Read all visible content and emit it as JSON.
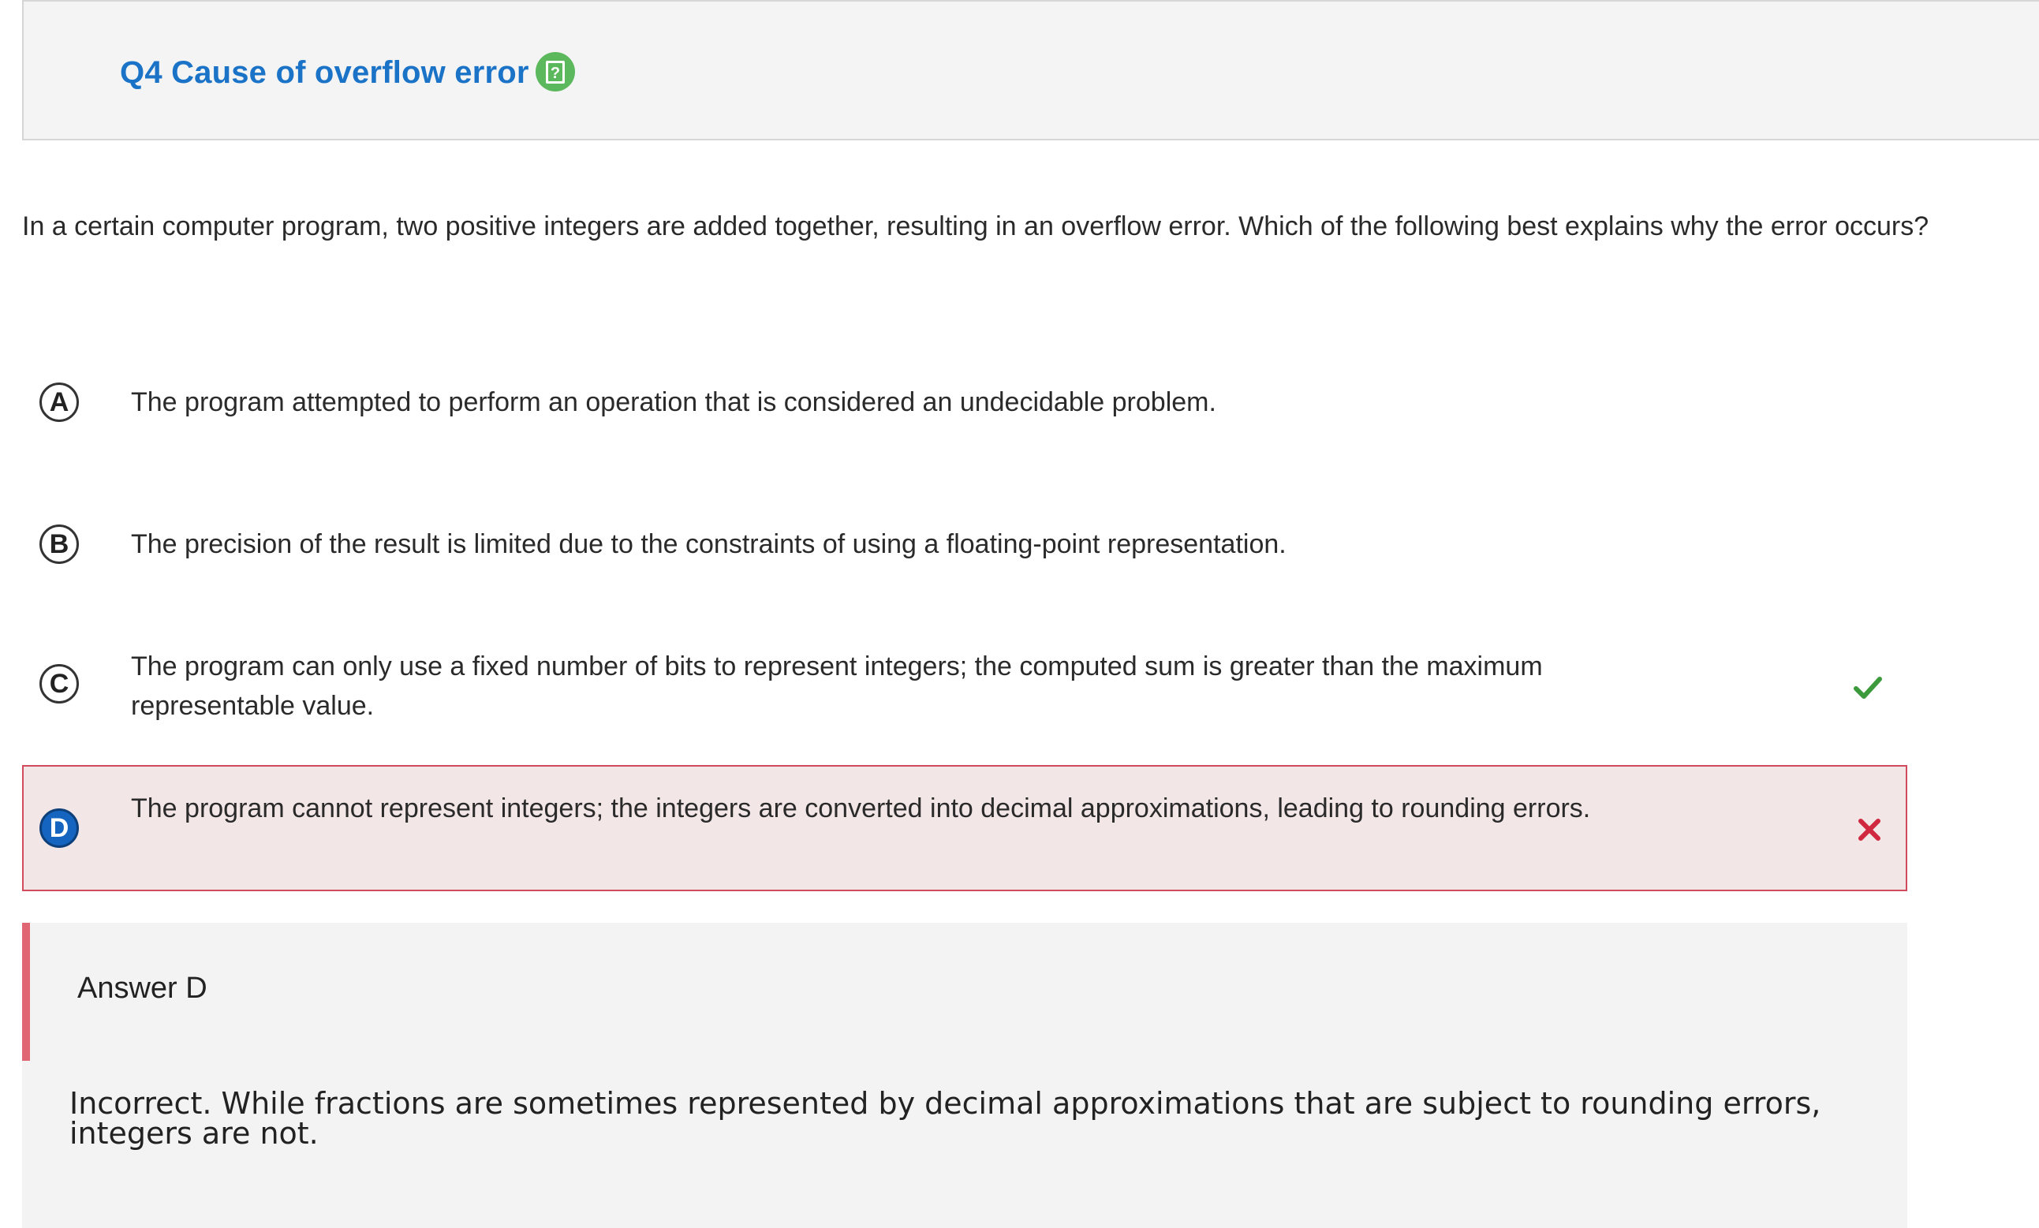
{
  "header": {
    "title": "Q4 Cause of overflow error",
    "help_icon": "help-question-icon"
  },
  "question": {
    "stem": "In a certain computer program, two positive integers are added together, resulting in an overflow error. Which of the following best explains why the error occurs?"
  },
  "options": [
    {
      "letter": "A",
      "text": "The program attempted to perform an operation that is considered an undecidable problem."
    },
    {
      "letter": "B",
      "text": "The precision of the result is limited due to the constraints of using a floating-point representation."
    },
    {
      "letter": "C",
      "text": "The program can only use a fixed number of bits to represent integers; the computed sum is greater than the maximum representable value.",
      "status": "correct"
    },
    {
      "letter": "D",
      "text": "The program cannot represent integers; the integers are converted into decimal approximations, leading to rounding errors.",
      "status": "selected-incorrect"
    }
  ],
  "answer": {
    "title": "Answer D",
    "explanation": "Incorrect. While fractions are sometimes represented by decimal approximations that are subject to rounding errors, integers are not."
  },
  "colors": {
    "title_blue": "#1a73c7",
    "help_green": "#5cb85c",
    "correct_green": "#3c9a3c",
    "incorrect_red": "#d0283f",
    "selected_bg": "#f3e6e6",
    "selected_border": "#d24a5e",
    "selected_circle": "#1565c0",
    "answer_bar": "#e06673"
  }
}
